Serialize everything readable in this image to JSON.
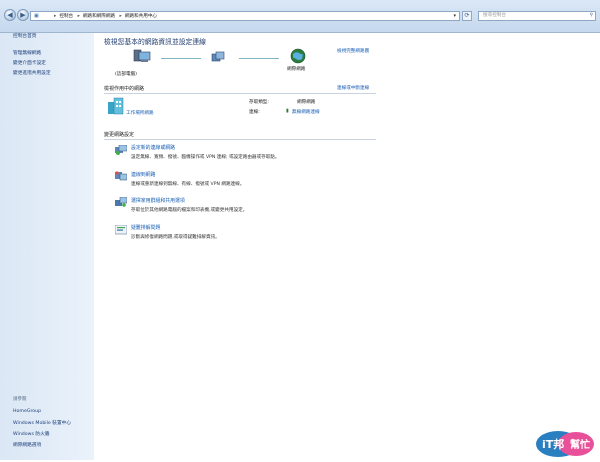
{
  "address_bar": {
    "crumbs": [
      "控制台",
      "網路和網際網路",
      "網路和共用中心"
    ],
    "search_placeholder": "搜尋控制台"
  },
  "sidebar": {
    "home": "控制台首頁",
    "tasks": [
      "管理無線網路",
      "變更介面卡設定",
      "變更進階共用設定"
    ],
    "see_also_heading": "請參閱",
    "see_also": [
      "HomeGroup",
      "Windows Mobile 裝置中心",
      "Windows 防火牆",
      "網際網路選項"
    ]
  },
  "main": {
    "title": "檢視您基本的網路資訊並設定連線",
    "full_map_link": "檢視完整網路圖",
    "map_nodes": [
      "(這部電腦)",
      "",
      "網際網路"
    ],
    "active_heading": "檢視作用中的網路",
    "connect_link": "連線或中斷連線",
    "network": {
      "type_label": "工作場所網路",
      "access_type_label": "存取類型:",
      "access_type_value": "網際網路",
      "connections_label": "連線:",
      "connections_value": "無線網路連線"
    },
    "change_heading": "變更網路設定",
    "tasks": [
      {
        "icon": "new-connection-icon",
        "title": "設定新的連線或網路",
        "desc": "設定無線、寬頻、撥號、臨機操作或 VPN 連線; 或設定路由器或存取點。"
      },
      {
        "icon": "connect-network-icon",
        "title": "連線到網路",
        "desc": "連線或重新連線到無線、有線、撥號或 VPN 網路連線。"
      },
      {
        "icon": "homegroup-icon",
        "title": "選擇家用群組和共用選項",
        "desc": "存取位於其他網路電腦的檔案和印表機,或變更共用設定。"
      },
      {
        "icon": "troubleshoot-icon",
        "title": "疑難排解問題",
        "desc": "診斷與修復網路問題,或取得疑難排解資訊。"
      }
    ]
  },
  "watermark": {
    "text1": "iT邦",
    "text2": "幫忙"
  }
}
